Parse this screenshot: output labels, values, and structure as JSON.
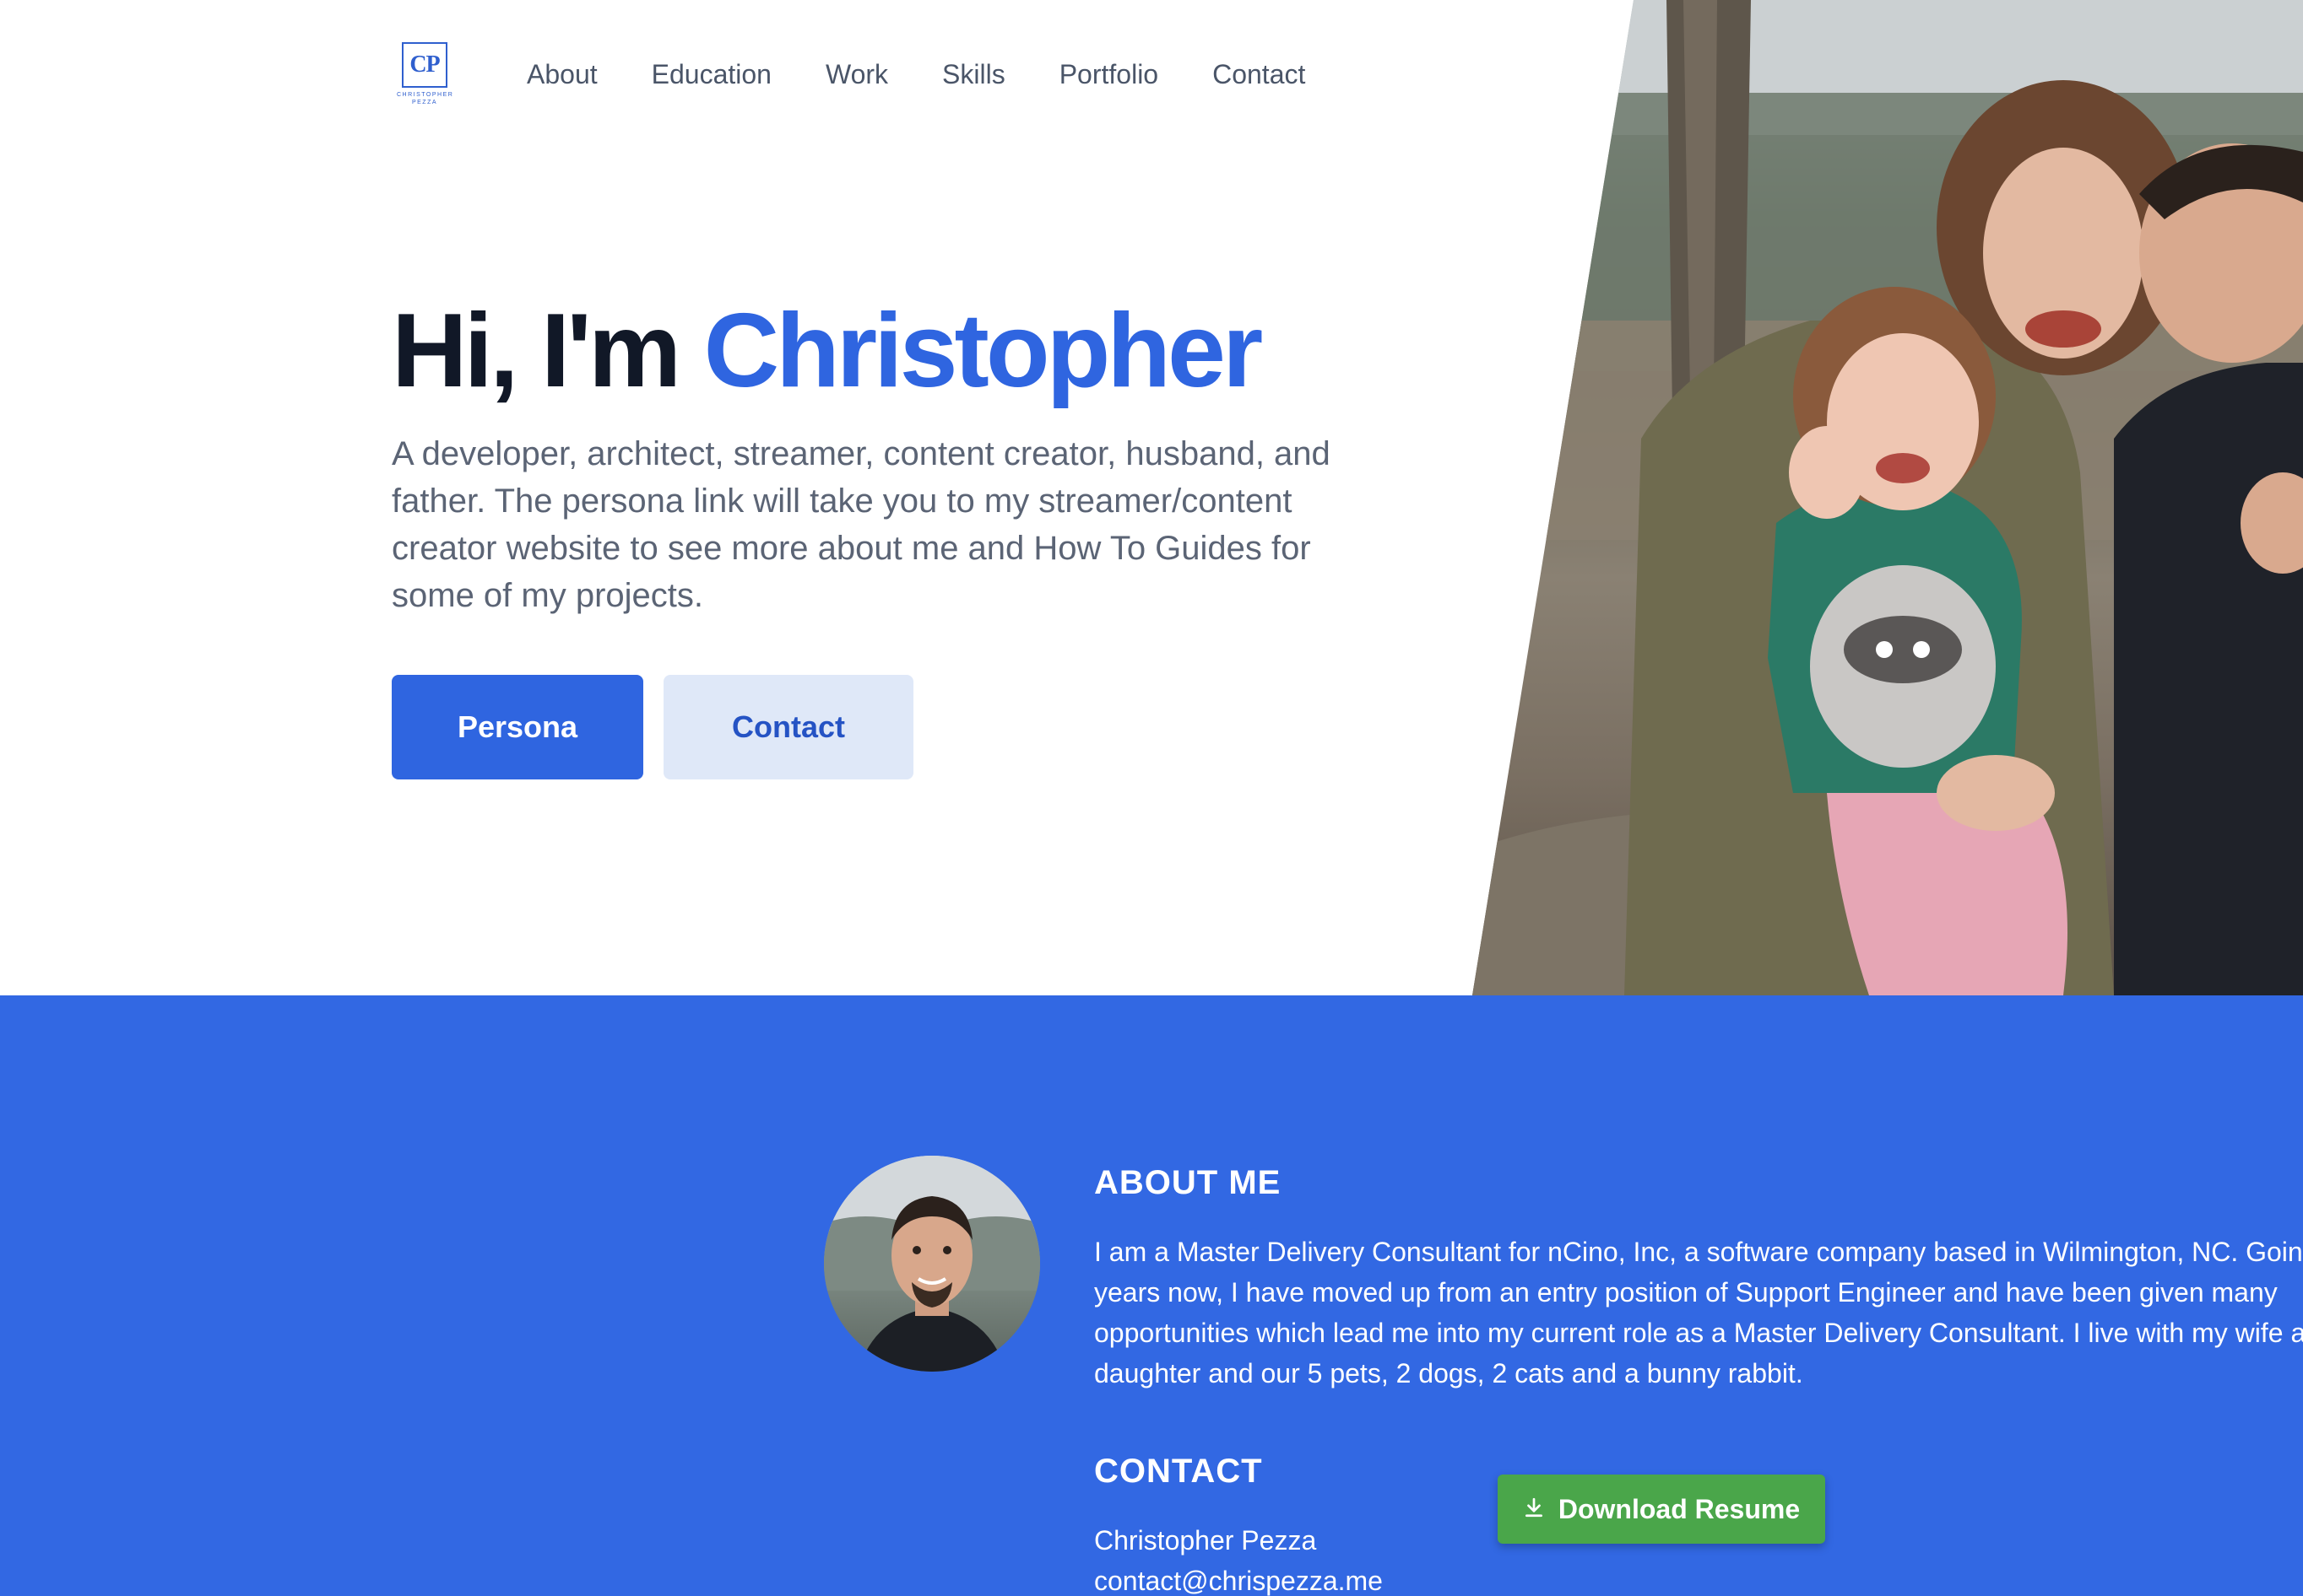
{
  "logo": {
    "initials": "CP",
    "subtext_line1": "CHRISTOPHER",
    "subtext_line2": "PEZZA"
  },
  "nav": {
    "items": [
      {
        "label": "About"
      },
      {
        "label": "Education"
      },
      {
        "label": "Work"
      },
      {
        "label": "Skills"
      },
      {
        "label": "Portfolio"
      },
      {
        "label": "Contact"
      }
    ]
  },
  "hero": {
    "greeting": "Hi, I'm",
    "name": "Christopher",
    "description": "A developer, architect, streamer, content creator, husband, and father. The persona link will take you to my streamer/content creator website to see more about me and How To Guides for some of my projects.",
    "primary_button": "Persona",
    "secondary_button": "Contact"
  },
  "about": {
    "heading": "ABOUT ME",
    "text": "I am a Master Delivery Consultant for nCino, Inc, a software company based in Wilmington, NC. Going on years now, I have moved up from an entry position of Support Engineer and have been given many opportunities which lead me into my current role as a Master Delivery Consultant. I live with my wife and daughter and our 5 pets, 2 dogs, 2 cats and a bunny rabbit."
  },
  "contact": {
    "heading": "CONTACT",
    "name": "Christopher Pezza",
    "email": "contact@chrispezza.me",
    "download_button": "Download Resume"
  },
  "colors": {
    "accent_blue": "#2f65e0",
    "section_blue": "#3268e3",
    "download_green": "#4aa64a"
  },
  "icons": {
    "download": "download-icon"
  }
}
